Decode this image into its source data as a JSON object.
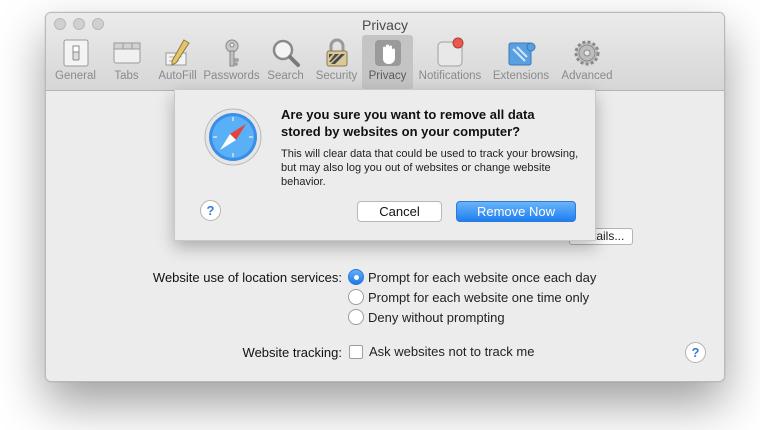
{
  "window": {
    "title": "Privacy",
    "toolbar": [
      {
        "label": "General",
        "icon": "general-switch-icon"
      },
      {
        "label": "Tabs",
        "icon": "tabs-icon"
      },
      {
        "label": "AutoFill",
        "icon": "autofill-pencil-icon"
      },
      {
        "label": "Passwords",
        "icon": "key-icon"
      },
      {
        "label": "Search",
        "icon": "search-magnifier-icon"
      },
      {
        "label": "Security",
        "icon": "padlock-icon"
      },
      {
        "label": "Privacy",
        "icon": "hand-icon",
        "selected": true
      },
      {
        "label": "Notifications",
        "icon": "notifications-icon"
      },
      {
        "label": "Extensions",
        "icon": "puzzle-icon"
      },
      {
        "label": "Advanced",
        "icon": "gear-icon"
      }
    ]
  },
  "privacy": {
    "details_label": "Details...",
    "location_label": "Website use of location services:",
    "location_options": [
      {
        "label": "Prompt for each website once each day",
        "selected": true
      },
      {
        "label": "Prompt for each website one time only",
        "selected": false
      },
      {
        "label": "Deny without prompting",
        "selected": false
      }
    ],
    "tracking_label": "Website tracking:",
    "tracking_option": "Ask websites not to track me",
    "tracking_checked": false,
    "help": "?"
  },
  "sheet": {
    "title": "Are you sure you want to remove all data stored by websites on your computer?",
    "body": "This will clear data that could be used to track your browsing, but may also log you out of websites or change website behavior.",
    "help": "?",
    "cancel_label": "Cancel",
    "confirm_label": "Remove Now"
  },
  "colors": {
    "accent": "#1f7ff0",
    "window_bg": "#ececec"
  }
}
